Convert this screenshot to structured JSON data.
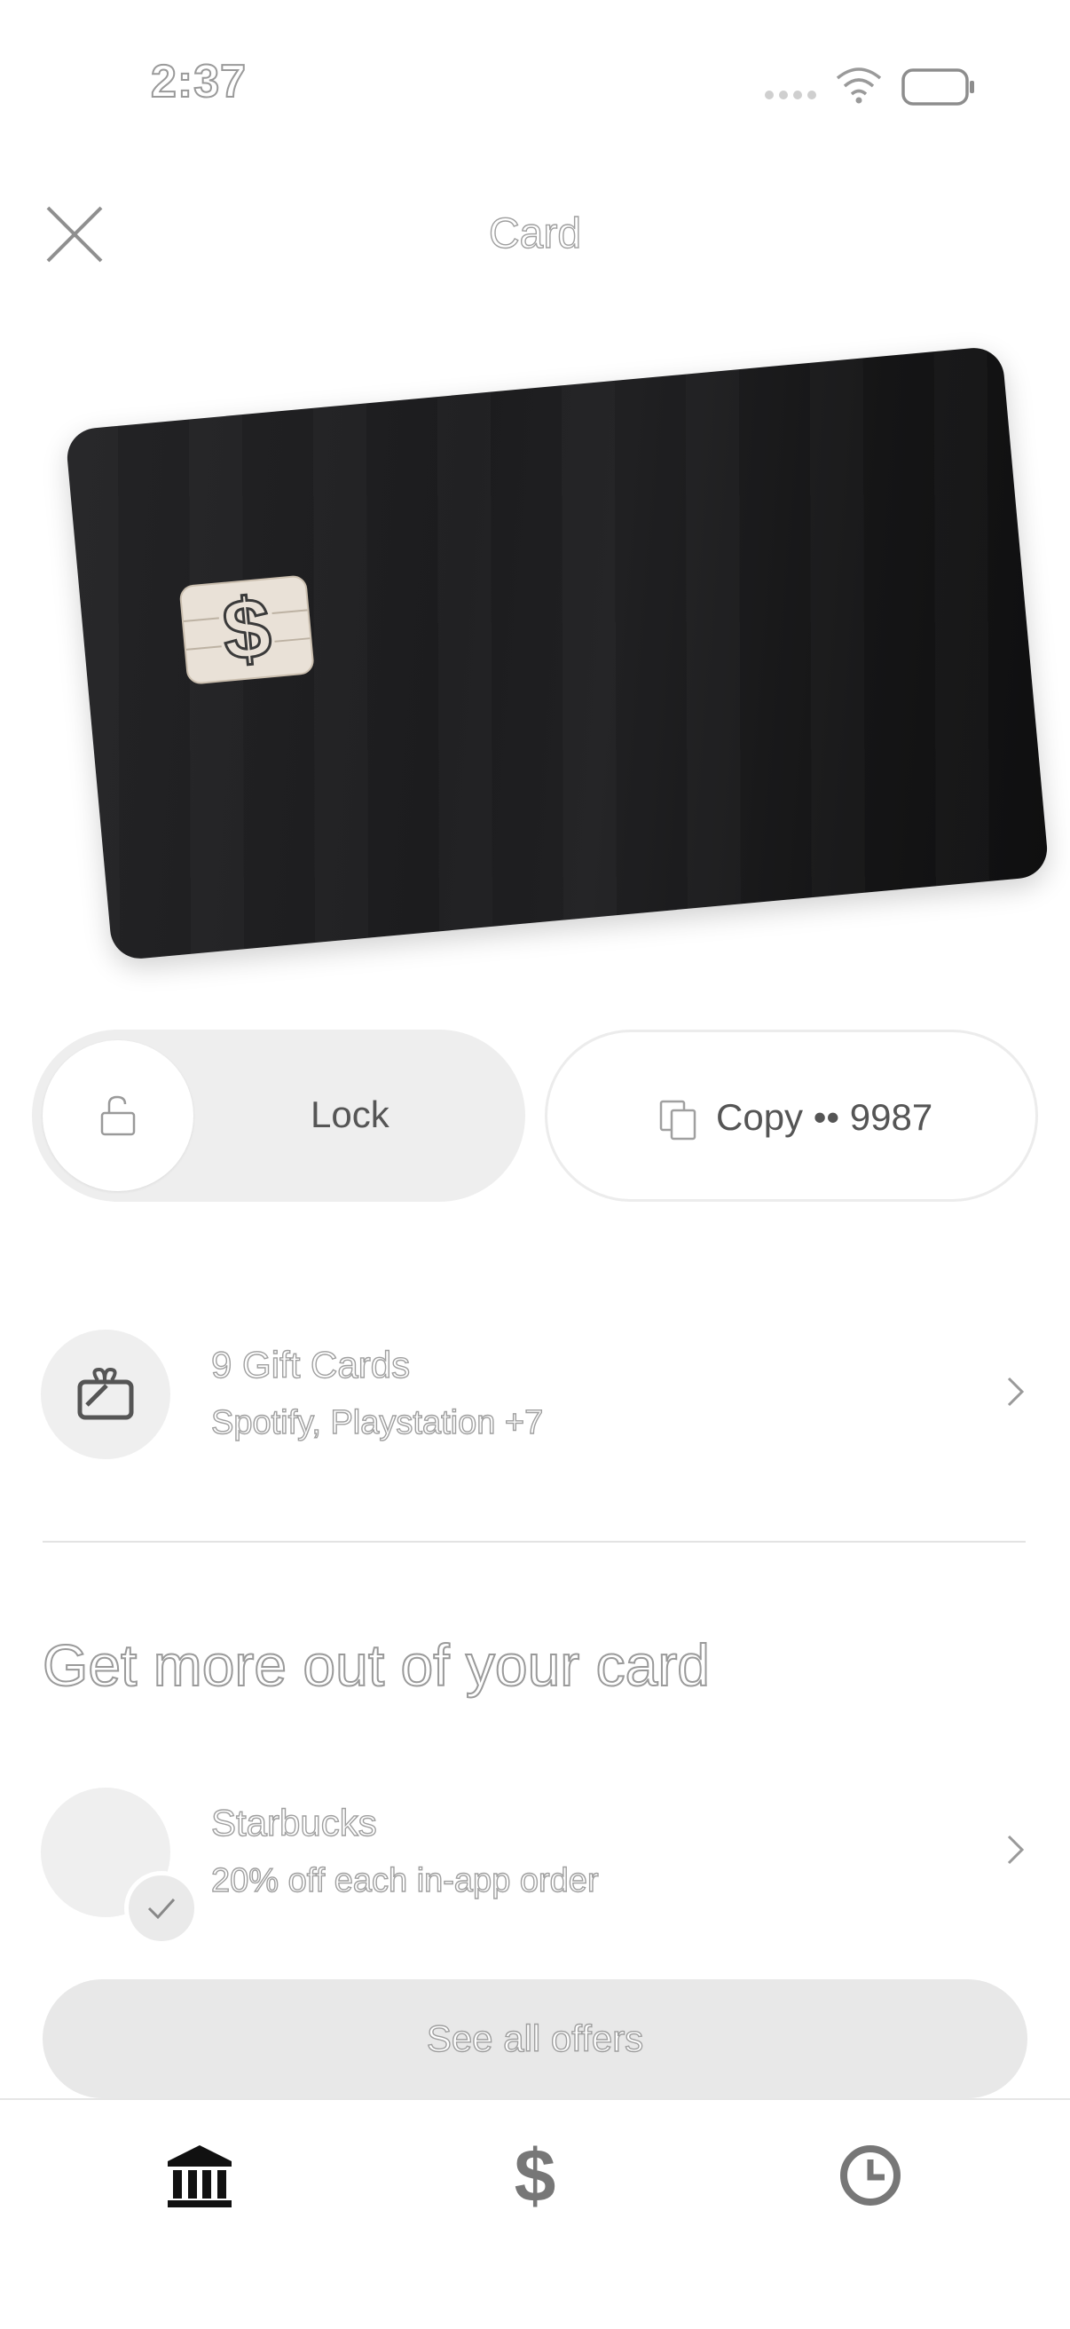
{
  "status_bar": {
    "time": "2:37"
  },
  "header": {
    "title": "Card"
  },
  "card": {
    "chip_icon": "dollar-chip-icon"
  },
  "actions": {
    "lock_label": "Lock",
    "copy_label": "Copy •• 9987"
  },
  "gift_cards": {
    "title": "9 Gift Cards",
    "subtitle": "Spotify, Playstation +7"
  },
  "offers_section": {
    "heading": "Get more out of your card",
    "offer": {
      "title": "Starbucks",
      "subtitle": "20% off each in-app order"
    },
    "see_all_label": "See all offers"
  },
  "nav": {
    "items": [
      {
        "icon": "bank-icon",
        "active": true
      },
      {
        "icon": "dollar-icon",
        "active": false
      },
      {
        "icon": "clock-icon",
        "active": false
      }
    ]
  },
  "colors": {
    "card": "#1c1c1e",
    "chip": "#e9e1d7",
    "pill_bg": "#eeeeee",
    "text_muted": "#555555"
  }
}
